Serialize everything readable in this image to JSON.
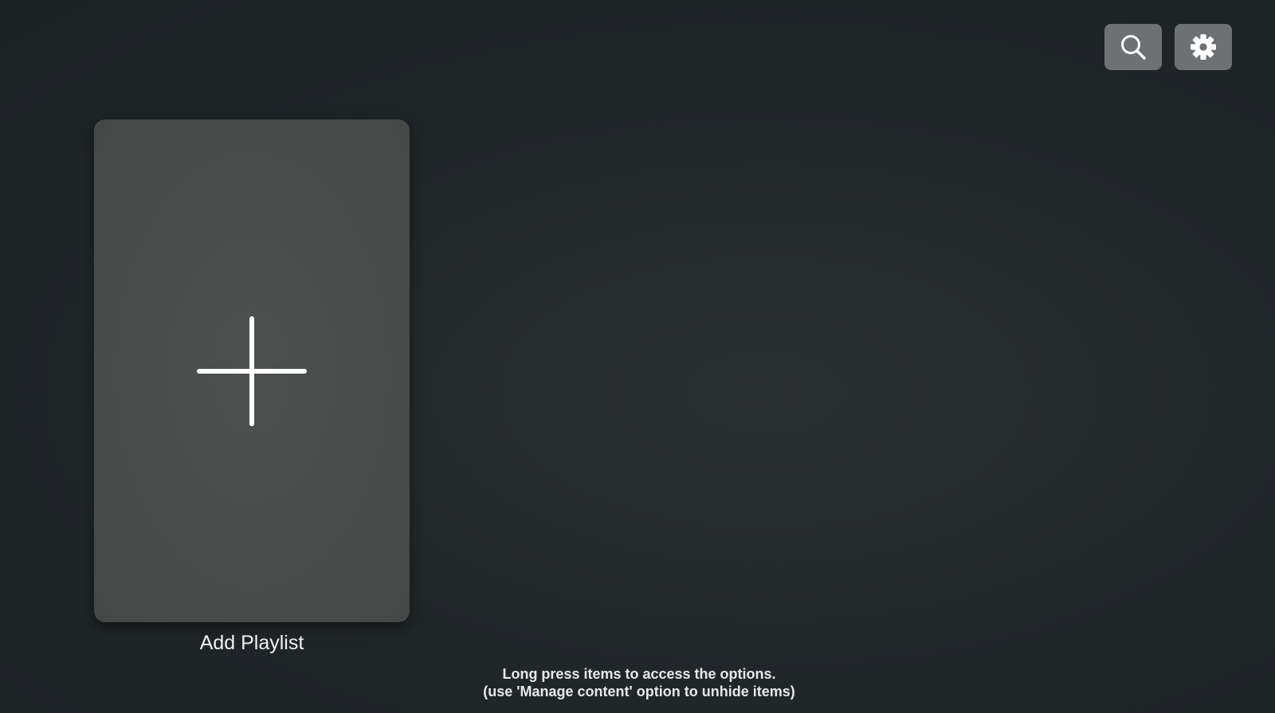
{
  "header": {
    "search_icon": "search-icon",
    "settings_icon": "gear-icon"
  },
  "tiles": [
    {
      "label": "Add Playlist",
      "icon": "plus-icon"
    }
  ],
  "hint": {
    "line1": "Long press items to access the options.",
    "line2": "(use 'Manage content' option to unhide items)"
  },
  "colors": {
    "background": "#22272a",
    "tile": "#4a4e4c",
    "button": "#6e7173",
    "foreground": "#ffffff"
  }
}
